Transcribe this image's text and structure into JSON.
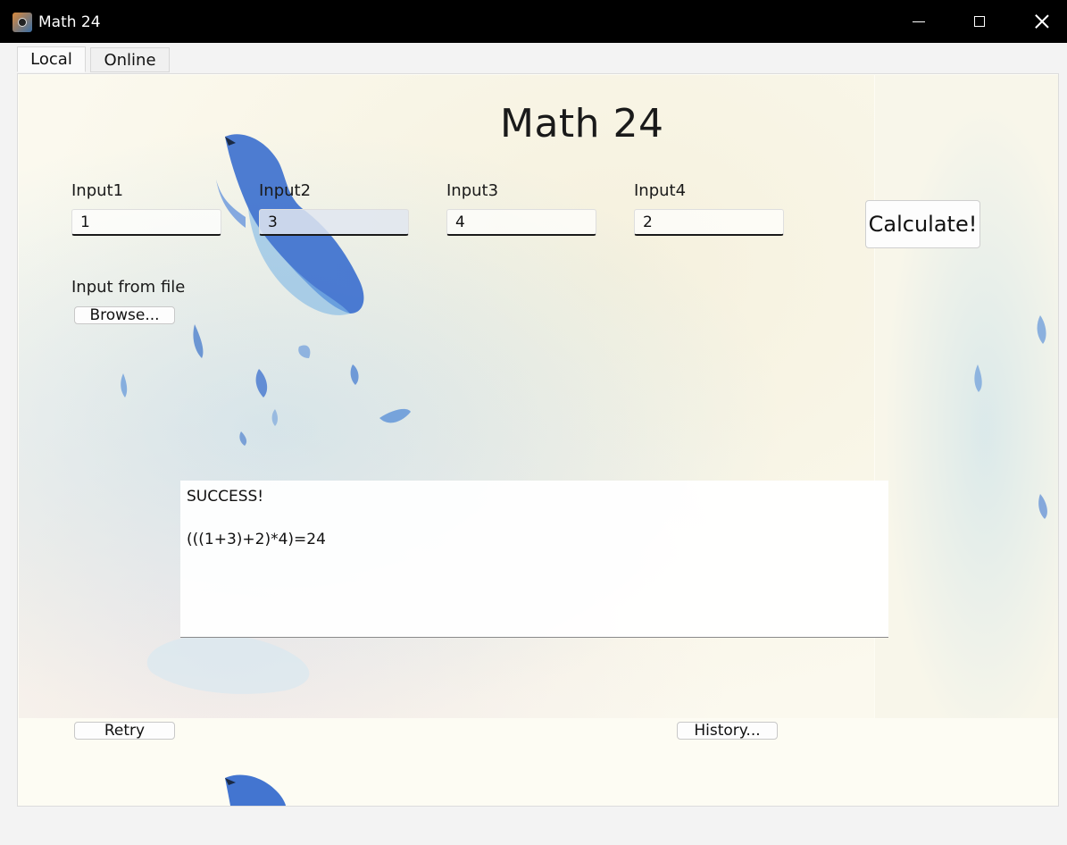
{
  "window": {
    "title": "Math 24"
  },
  "tabs": [
    {
      "label": "Local",
      "active": true
    },
    {
      "label": "Online",
      "active": false
    }
  ],
  "main": {
    "heading": "Math 24",
    "inputs": [
      {
        "label": "Input1",
        "value": "1"
      },
      {
        "label": "Input2",
        "value": "3"
      },
      {
        "label": "Input3",
        "value": "4"
      },
      {
        "label": "Input4",
        "value": "2"
      }
    ],
    "calculate_label": "Calculate!",
    "file_label": "Input from file",
    "browse_label": "Browse...",
    "result": {
      "status": "SUCCESS!",
      "expression": "(((1+3)+2)*4)=24"
    },
    "retry_label": "Retry",
    "history_label": "History..."
  },
  "colors": {
    "titlebar": "#000000",
    "accent_bird": "#2a5fc8"
  }
}
